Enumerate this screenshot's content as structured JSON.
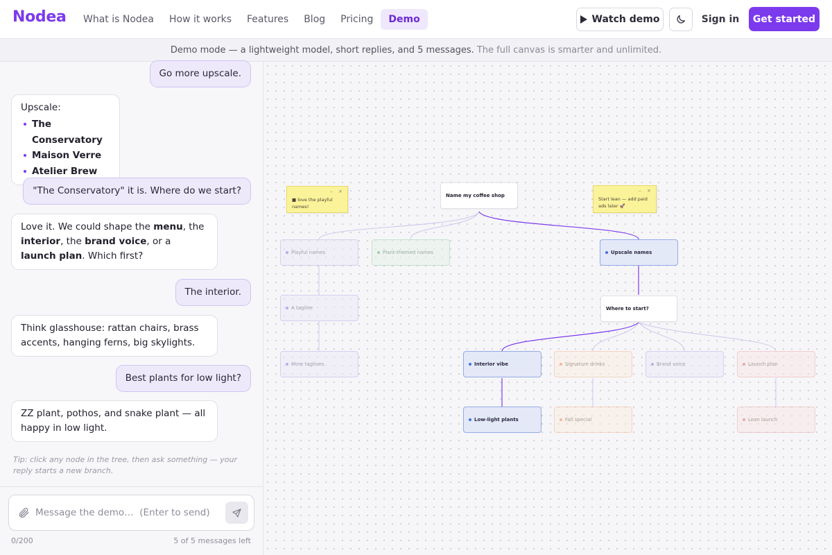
{
  "nav": {
    "logo": "Nodea",
    "links": [
      {
        "label": "What is Nodea",
        "active": false
      },
      {
        "label": "How it works",
        "active": false
      },
      {
        "label": "Features",
        "active": false
      },
      {
        "label": "Blog",
        "active": false
      },
      {
        "label": "Pricing",
        "active": false
      },
      {
        "label": "Demo",
        "active": true
      }
    ],
    "watch_demo": "Watch demo",
    "theme_icon": "moon-icon",
    "sign_in": "Sign in",
    "get_started": "Get started"
  },
  "banner": {
    "main": "Demo mode — a lightweight model, short replies, and 5 messages.",
    "secondary": "The full canvas is smarter and unlimited."
  },
  "chat": {
    "messages": [
      {
        "role": "user",
        "text": "Go more upscale."
      },
      {
        "role": "bot",
        "intro": "Upscale:",
        "items": [
          "The Conservatory",
          "Maison Verre",
          "Atelier Brew"
        ]
      },
      {
        "role": "user",
        "text": "\"The Conservatory\" it is. Where do we start?"
      },
      {
        "role": "bot",
        "parts": [
          "Love it. We could shape the ",
          "menu",
          ", the ",
          "interior",
          ", the ",
          "brand voice",
          ", or a ",
          "launch plan",
          ". Which first?"
        ]
      },
      {
        "role": "user",
        "text": "The interior."
      },
      {
        "role": "bot",
        "text": "Think glasshouse: rattan chairs, brass accents, hanging ferns, big skylights."
      },
      {
        "role": "user",
        "text": "Best plants for low light?"
      },
      {
        "role": "bot",
        "text": "ZZ plant, pothos, and snake plant — all happy in low light."
      }
    ],
    "tip": "Tip: click any node in the tree, then ask something — your reply starts a new branch.",
    "input_placeholder": "Message the demo…  (Enter to send)",
    "input_value": "",
    "char_count": "0/200",
    "messages_left": "5 of 5 messages left"
  },
  "canvas": {
    "stickies": [
      {
        "text": "love the playful names!",
        "marker": "■"
      },
      {
        "text": "Start lean — add paid ads later 🚀"
      }
    ],
    "sticky_controls": "– ×",
    "nodes": {
      "root": "Name my coffee shop",
      "playful": "Playful names",
      "plant_themed": "Plant-themed names",
      "upscale": "Upscale names",
      "tagline": "A tagline",
      "more_taglines": "More taglines",
      "where_start": "Where to start?",
      "interior": "Interior vibe",
      "signature": "Signature drinks",
      "brand_voice": "Brand voice",
      "launch_plan": "Launch plan",
      "low_light": "Low-light plants",
      "fall_special": "Fall special",
      "lean_launch": "Lean launch"
    },
    "colors": {
      "accent": "#7c3aed",
      "active_edge": "#7c3aed",
      "faded_edge": "#c9c2ea"
    }
  }
}
